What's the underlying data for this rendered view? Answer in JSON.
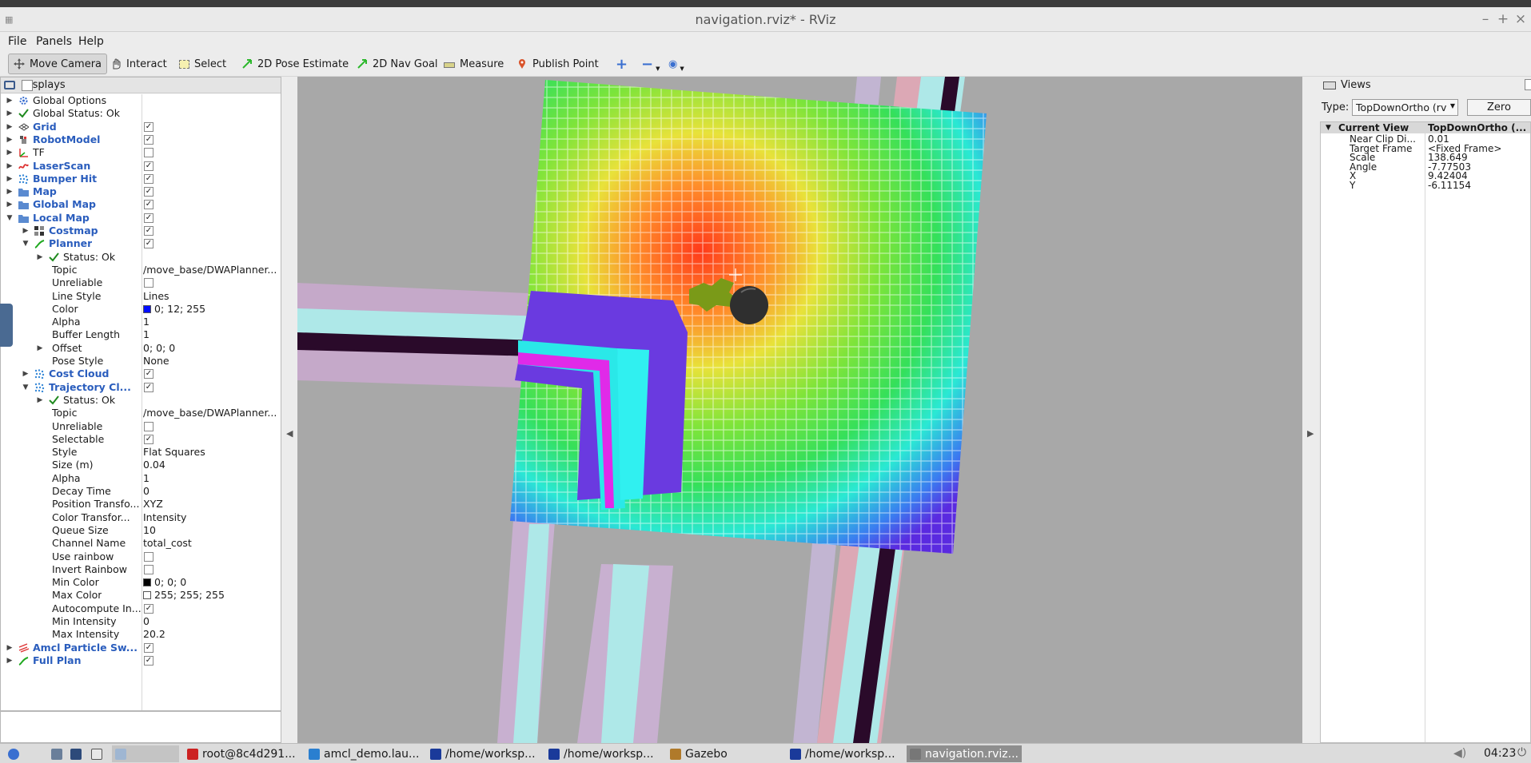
{
  "window": {
    "title": "navigation.rviz* - RViz"
  },
  "menu": [
    "File",
    "Panels",
    "Help"
  ],
  "toolbar": {
    "move_camera": "Move Camera",
    "interact": "Interact",
    "select": "Select",
    "pose_estimate": "2D Pose Estimate",
    "nav_goal": "2D Nav Goal",
    "measure": "Measure",
    "publish_point": "Publish Point"
  },
  "displays": {
    "title": "Displays",
    "rows": [
      {
        "label": "Global Options",
        "exp": "▶",
        "indent": 0,
        "icon": "gear"
      },
      {
        "label": "Global Status: Ok",
        "exp": "▶",
        "indent": 0,
        "icon": "check"
      },
      {
        "label": "Grid",
        "exp": "▶",
        "indent": 0,
        "icon": "grid",
        "blue": true,
        "check": true
      },
      {
        "label": "RobotModel",
        "exp": "▶",
        "indent": 0,
        "icon": "robot",
        "blue": true,
        "check": true
      },
      {
        "label": "TF",
        "exp": "▶",
        "indent": 0,
        "icon": "tf",
        "check": false
      },
      {
        "label": "LaserScan",
        "exp": "▶",
        "indent": 0,
        "icon": "laser",
        "blue": true,
        "check": true
      },
      {
        "label": "Bumper Hit",
        "exp": "▶",
        "indent": 0,
        "icon": "points",
        "blue": true,
        "check": true
      },
      {
        "label": "Map",
        "exp": "▶",
        "indent": 0,
        "icon": "folder",
        "blue": true,
        "check": true
      },
      {
        "label": "Global Map",
        "exp": "▶",
        "indent": 0,
        "icon": "folder",
        "blue": true,
        "check": true
      },
      {
        "label": "Local Map",
        "exp": "▼",
        "indent": 0,
        "icon": "folder",
        "blue": true,
        "check": true
      },
      {
        "label": "Costmap",
        "exp": "▶",
        "indent": 1,
        "icon": "costmap",
        "blue": true,
        "check": true
      },
      {
        "label": "Planner",
        "exp": "▼",
        "indent": 1,
        "icon": "path",
        "blue": true,
        "check": true
      },
      {
        "label": "Status: Ok",
        "exp": "▶",
        "indent": 2,
        "icon": "check"
      },
      {
        "label": "Topic",
        "indent": 2,
        "value": "/move_base/DWAPlanner..."
      },
      {
        "label": "Unreliable",
        "indent": 2,
        "check": false
      },
      {
        "label": "Line Style",
        "indent": 2,
        "value": "Lines"
      },
      {
        "label": "Color",
        "indent": 2,
        "value": "0; 12; 255",
        "swatch": "#000cff"
      },
      {
        "label": "Alpha",
        "indent": 2,
        "value": "1"
      },
      {
        "label": "Buffer Length",
        "indent": 2,
        "value": "1"
      },
      {
        "label": "Offset",
        "exp": "▶",
        "indent": 2,
        "value": "0; 0; 0"
      },
      {
        "label": "Pose Style",
        "indent": 2,
        "value": "None"
      },
      {
        "label": "Cost Cloud",
        "exp": "▶",
        "indent": 1,
        "icon": "points",
        "blue": true,
        "check": true
      },
      {
        "label": "Trajectory Cl...",
        "exp": "▼",
        "indent": 1,
        "icon": "points",
        "blue": true,
        "check": true
      },
      {
        "label": "Status: Ok",
        "exp": "▶",
        "indent": 2,
        "icon": "check"
      },
      {
        "label": "Topic",
        "indent": 2,
        "value": "/move_base/DWAPlanner..."
      },
      {
        "label": "Unreliable",
        "indent": 2,
        "check": false
      },
      {
        "label": "Selectable",
        "indent": 2,
        "check": true
      },
      {
        "label": "Style",
        "indent": 2,
        "value": "Flat Squares"
      },
      {
        "label": "Size (m)",
        "indent": 2,
        "value": "0.04"
      },
      {
        "label": "Alpha",
        "indent": 2,
        "value": "1"
      },
      {
        "label": "Decay Time",
        "indent": 2,
        "value": "0"
      },
      {
        "label": "Position Transfo...",
        "indent": 2,
        "value": "XYZ"
      },
      {
        "label": "Color Transfor...",
        "indent": 2,
        "value": "Intensity"
      },
      {
        "label": "Queue Size",
        "indent": 2,
        "value": "10"
      },
      {
        "label": "Channel Name",
        "indent": 2,
        "value": "total_cost"
      },
      {
        "label": "Use rainbow",
        "indent": 2,
        "check": false
      },
      {
        "label": "Invert Rainbow",
        "indent": 2,
        "check": false
      },
      {
        "label": "Min Color",
        "indent": 2,
        "value": "0; 0; 0",
        "swatch": "#000000"
      },
      {
        "label": "Max Color",
        "indent": 2,
        "value": "255; 255; 255",
        "swatch": "#ffffff"
      },
      {
        "label": "Autocompute In...",
        "indent": 2,
        "check": true
      },
      {
        "label": "Min Intensity",
        "indent": 2,
        "value": "0"
      },
      {
        "label": "Max Intensity",
        "indent": 2,
        "value": "20.2"
      },
      {
        "label": "Amcl Particle Sw...",
        "exp": "▶",
        "indent": 0,
        "icon": "arrows",
        "blue": true,
        "check": true
      },
      {
        "label": "Full Plan",
        "exp": "▶",
        "indent": 0,
        "icon": "path",
        "blue": true,
        "check": true
      }
    ]
  },
  "views": {
    "title": "Views",
    "type_label": "Type:",
    "type_value": "TopDownOrtho (rv",
    "zero_button": "Zero",
    "current_view_label": "Current View",
    "current_view_value": "TopDownOrtho (...",
    "props": [
      {
        "label": "Near Clip Di...",
        "value": "0.01"
      },
      {
        "label": "Target Frame",
        "value": "<Fixed Frame>"
      },
      {
        "label": "Scale",
        "value": "138.649"
      },
      {
        "label": "Angle",
        "value": "-7.77503"
      },
      {
        "label": "X",
        "value": "9.42404"
      },
      {
        "label": "Y",
        "value": "-6.11154"
      }
    ]
  },
  "taskbar": {
    "items": [
      "root@8c4d291...",
      "amcl_demo.lau...",
      "/home/worksp...",
      "/home/worksp...",
      "Gazebo",
      "/home/worksp...",
      "navigation.rviz..."
    ],
    "clock": "04:23"
  }
}
